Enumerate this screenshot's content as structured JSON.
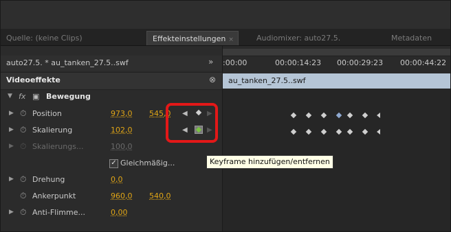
{
  "tabs": [
    {
      "label": "Quelle: (keine Clips)",
      "active": false
    },
    {
      "label": "Effekteinstellungen",
      "active": true,
      "close": "×"
    },
    {
      "label": "Audiomixer: auto27.5.",
      "active": false
    },
    {
      "label": "Metadaten",
      "active": false
    }
  ],
  "clip_header": {
    "title": "auto27.5. * au_tanken_27.5..swf",
    "nav_icon": "double-chevron-right-icon"
  },
  "video_effects": {
    "label": "Videoeffekte",
    "reset_icon": "reset-icon"
  },
  "motion": {
    "label": "Bewegung",
    "fx": "fx"
  },
  "properties": [
    {
      "label": "Position",
      "v1": "973,0",
      "v2": "545,0"
    },
    {
      "label": "Skalierung",
      "v1": "102,0"
    },
    {
      "label": "Skalierungs...",
      "v1": "100,0"
    },
    {
      "label": "Gleichmäßig..."
    },
    {
      "label": "Drehung",
      "v1": "0,0"
    },
    {
      "label": "Ankerpunkt",
      "v1": "960,0",
      "v2": "540,0"
    },
    {
      "label": "Anti-Flimme...",
      "v1": "0,00"
    }
  ],
  "timeline": {
    "ticks": [
      ":00:00",
      "00:00:14:23",
      "00:00:29:23",
      "00:00:44:22"
    ],
    "clip_name": "au_tanken_27.5..swf"
  },
  "tooltip": "Keyframe hinzufügen/entfernen",
  "colors": {
    "value": "#e0a516",
    "highlight": "#e31818",
    "clip_track": "#b5c5d6"
  }
}
